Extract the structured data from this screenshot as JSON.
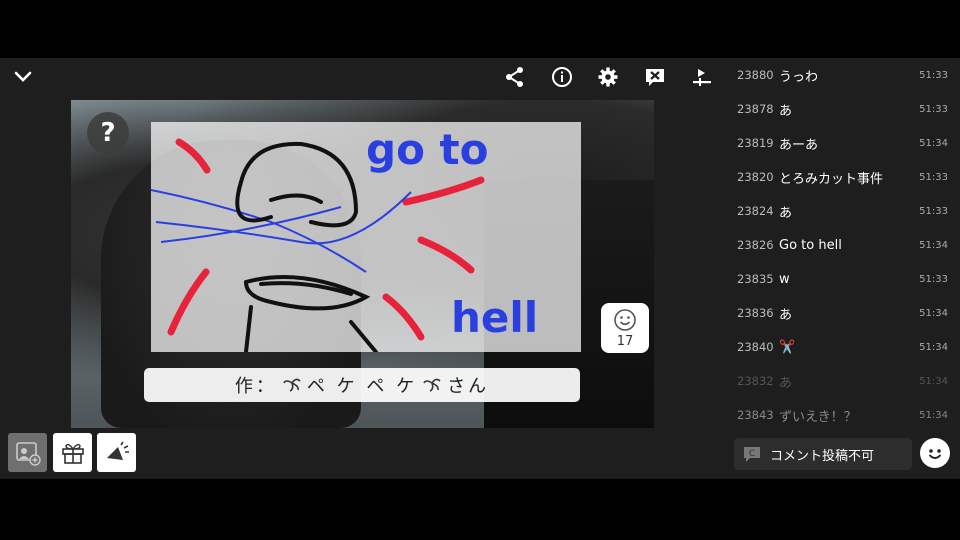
{
  "colors": {
    "background": "#000000",
    "app_bg": "#1e1e1e",
    "drawing_red": "#e8223a",
    "drawing_blue": "#2a3fe0",
    "drawing_black": "#111111"
  },
  "toolbar": {
    "icons": [
      "chevron-down-icon",
      "share-icon",
      "info-icon",
      "gear-icon",
      "close-x-icon",
      "transfer-icon"
    ]
  },
  "player": {
    "help_label": "?",
    "drawing_text": [
      "go to",
      "hell"
    ],
    "reaction_count": "17",
    "credit_prefix": "作：",
    "credit_name": "ペ ケ ペ ケ",
    "credit_suffix": "さん"
  },
  "bottom_buttons": [
    "add-user-icon",
    "gift-icon",
    "megaphone-icon"
  ],
  "comments": [
    {
      "no": "23880",
      "text": "うっわ",
      "time": "51:33"
    },
    {
      "no": "23878",
      "text": "あ",
      "time": "51:33"
    },
    {
      "no": "23819",
      "text": "あーあ",
      "time": "51:34"
    },
    {
      "no": "23820",
      "text": "とろみカット事件",
      "time": "51:33"
    },
    {
      "no": "23824",
      "text": "あ",
      "time": "51:33"
    },
    {
      "no": "23826",
      "text": "Go to hell",
      "time": "51:34"
    },
    {
      "no": "23835",
      "text": "w",
      "time": "51:33"
    },
    {
      "no": "23836",
      "text": "あ",
      "time": "51:34"
    },
    {
      "no": "23840",
      "text": "✂️",
      "time": "51:34"
    },
    {
      "no": "23832",
      "text": "あ",
      "time": "51:34"
    },
    {
      "no": "23843",
      "text": "ずいえき！？",
      "time": "51:34"
    }
  ],
  "comment_input": {
    "placeholder": "コメント投稿不可"
  }
}
